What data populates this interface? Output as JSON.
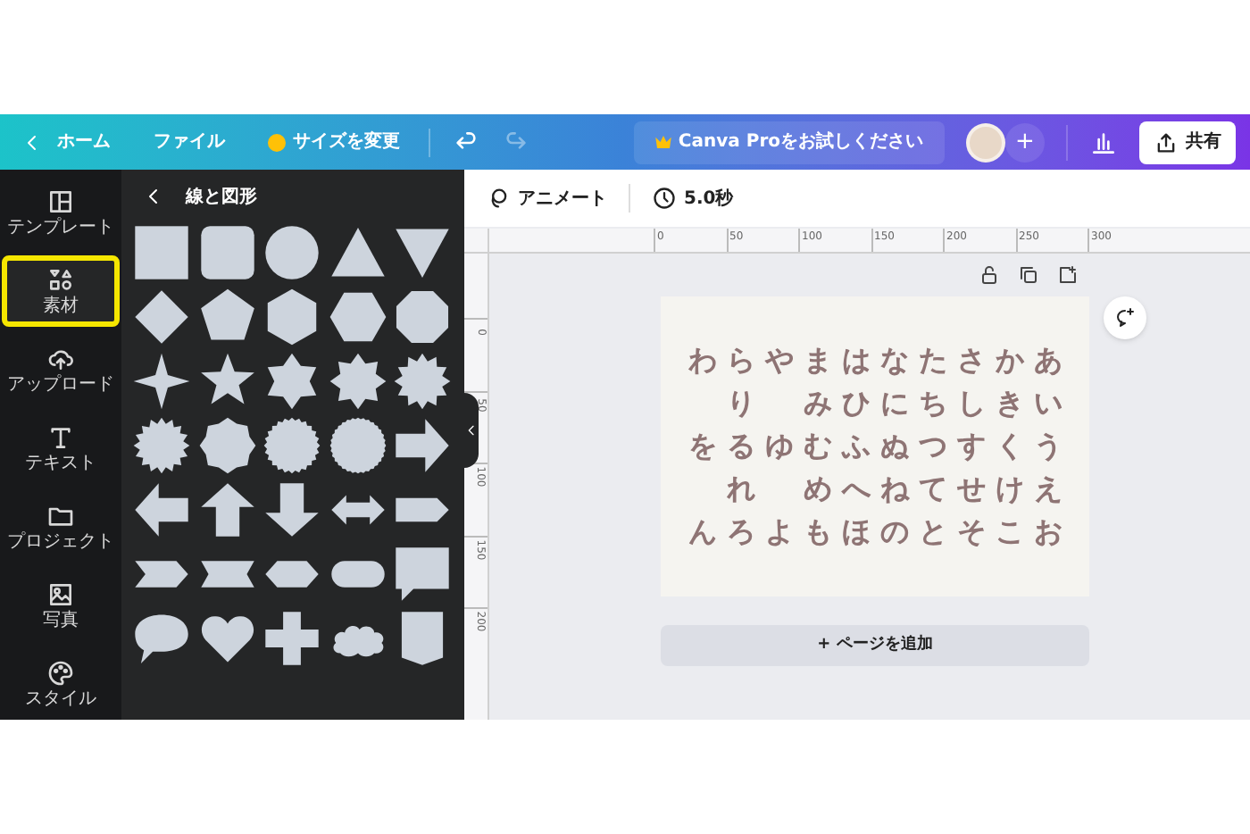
{
  "topbar": {
    "home": "ホーム",
    "file": "ファイル",
    "resize": "サイズを変更",
    "undo": {
      "disabled": false
    },
    "redo": {
      "disabled": true
    },
    "pro": "Canva Proをお試しください",
    "plus": "+",
    "share": "共有"
  },
  "sidebar": {
    "items": [
      {
        "label": "テンプレート",
        "selected": false
      },
      {
        "label": "素材",
        "selected": true
      },
      {
        "label": "アップロード",
        "selected": false
      },
      {
        "label": "テキスト",
        "selected": false
      },
      {
        "label": "プロジェクト",
        "selected": false
      },
      {
        "label": "写真",
        "selected": false
      },
      {
        "label": "スタイル",
        "selected": false
      }
    ]
  },
  "panel": {
    "title": "線と図形"
  },
  "toolbar": {
    "animate": "アニメート",
    "duration": "5.0秒"
  },
  "ruler": {
    "horizontal": [
      "0",
      "50",
      "100",
      "150",
      "200",
      "250",
      "300"
    ],
    "vertical": [
      "0",
      "50",
      "100",
      "150",
      "200"
    ]
  },
  "page": {
    "rows": [
      [
        "わ",
        "ら",
        "や",
        "ま",
        "は",
        "な",
        "た",
        "さ",
        "か",
        "あ"
      ],
      [
        "",
        "り",
        "",
        "み",
        "ひ",
        "に",
        "ち",
        "し",
        "き",
        "い"
      ],
      [
        "を",
        "る",
        "ゆ",
        "む",
        "ふ",
        "ぬ",
        "つ",
        "す",
        "く",
        "う"
      ],
      [
        "",
        "れ",
        "",
        "め",
        "へ",
        "ね",
        "て",
        "せ",
        "け",
        "え"
      ],
      [
        "ん",
        "ろ",
        "よ",
        "も",
        "ほ",
        "の",
        "と",
        "そ",
        "こ",
        "お"
      ]
    ]
  },
  "add_page": "+ ページを追加"
}
